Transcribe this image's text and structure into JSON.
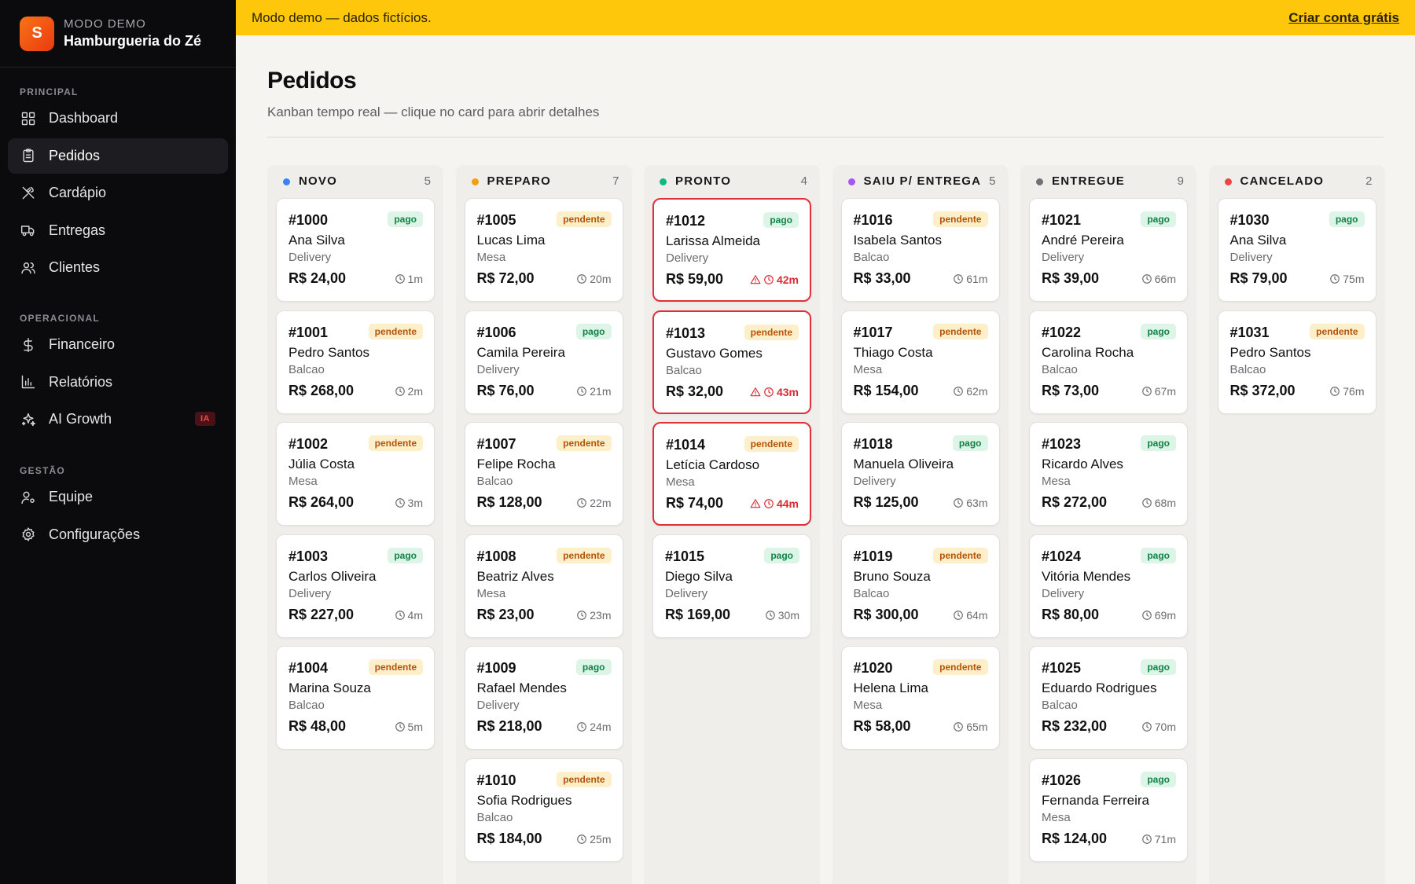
{
  "banner": {
    "text": "Modo demo — dados fictícios.",
    "cta": "Criar conta grátis"
  },
  "brand": {
    "logo_letter": "S",
    "mode": "MODO DEMO",
    "name": "Hamburgueria do Zé"
  },
  "sidebar": {
    "sections": [
      {
        "label": "PRINCIPAL",
        "items": [
          {
            "label": "Dashboard",
            "icon": "grid-icon",
            "active": false
          },
          {
            "label": "Pedidos",
            "icon": "clipboard-icon",
            "active": true
          },
          {
            "label": "Cardápio",
            "icon": "utensils-icon",
            "active": false
          },
          {
            "label": "Entregas",
            "icon": "truck-icon",
            "active": false
          },
          {
            "label": "Clientes",
            "icon": "users-icon",
            "active": false
          }
        ]
      },
      {
        "label": "OPERACIONAL",
        "items": [
          {
            "label": "Financeiro",
            "icon": "dollar-icon",
            "active": false
          },
          {
            "label": "Relatórios",
            "icon": "bar-chart-icon",
            "active": false
          },
          {
            "label": "AI Growth",
            "icon": "sparkles-icon",
            "active": false,
            "badge": "IA"
          }
        ]
      },
      {
        "label": "GESTÃO",
        "items": [
          {
            "label": "Equipe",
            "icon": "user-cog-icon",
            "active": false
          },
          {
            "label": "Configurações",
            "icon": "settings-icon",
            "active": false
          }
        ]
      }
    ]
  },
  "header": {
    "title": "Pedidos",
    "subtitle": "Kanban tempo real — clique no card para abrir detalhes"
  },
  "colors": {
    "novo": "#3b82f6",
    "preparo": "#f59e0b",
    "pronto": "#10b981",
    "saiu": "#a855f7",
    "entregue": "#71717a",
    "cancelado": "#ef4444",
    "late": "#e0313a"
  },
  "columns": [
    {
      "key": "novo",
      "title": "NOVO",
      "count": "5",
      "cards": [
        {
          "id": "#1000",
          "name": "Ana Silva",
          "type": "Delivery",
          "price": "R$ 24,00",
          "time": "1m",
          "status": "pago"
        },
        {
          "id": "#1001",
          "name": "Pedro Santos",
          "type": "Balcao",
          "price": "R$ 268,00",
          "time": "2m",
          "status": "pendente"
        },
        {
          "id": "#1002",
          "name": "Júlia Costa",
          "type": "Mesa",
          "price": "R$ 264,00",
          "time": "3m",
          "status": "pendente"
        },
        {
          "id": "#1003",
          "name": "Carlos Oliveira",
          "type": "Delivery",
          "price": "R$ 227,00",
          "time": "4m",
          "status": "pago"
        },
        {
          "id": "#1004",
          "name": "Marina Souza",
          "type": "Balcao",
          "price": "R$ 48,00",
          "time": "5m",
          "status": "pendente"
        }
      ]
    },
    {
      "key": "preparo",
      "title": "PREPARO",
      "count": "7",
      "cards": [
        {
          "id": "#1005",
          "name": "Lucas Lima",
          "type": "Mesa",
          "price": "R$ 72,00",
          "time": "20m",
          "status": "pendente"
        },
        {
          "id": "#1006",
          "name": "Camila Pereira",
          "type": "Delivery",
          "price": "R$ 76,00",
          "time": "21m",
          "status": "pago"
        },
        {
          "id": "#1007",
          "name": "Felipe Rocha",
          "type": "Balcao",
          "price": "R$ 128,00",
          "time": "22m",
          "status": "pendente"
        },
        {
          "id": "#1008",
          "name": "Beatriz Alves",
          "type": "Mesa",
          "price": "R$ 23,00",
          "time": "23m",
          "status": "pendente"
        },
        {
          "id": "#1009",
          "name": "Rafael Mendes",
          "type": "Delivery",
          "price": "R$ 218,00",
          "time": "24m",
          "status": "pago"
        },
        {
          "id": "#1010",
          "name": "Sofia Rodrigues",
          "type": "Balcao",
          "price": "R$ 184,00",
          "time": "25m",
          "status": "pendente"
        }
      ]
    },
    {
      "key": "pronto",
      "title": "PRONTO",
      "count": "4",
      "cards": [
        {
          "id": "#1012",
          "name": "Larissa Almeida",
          "type": "Delivery",
          "price": "R$ 59,00",
          "time": "42m",
          "status": "pago",
          "late": true
        },
        {
          "id": "#1013",
          "name": "Gustavo Gomes",
          "type": "Balcao",
          "price": "R$ 32,00",
          "time": "43m",
          "status": "pendente",
          "late": true
        },
        {
          "id": "#1014",
          "name": "Letícia Cardoso",
          "type": "Mesa",
          "price": "R$ 74,00",
          "time": "44m",
          "status": "pendente",
          "late": true
        },
        {
          "id": "#1015",
          "name": "Diego Silva",
          "type": "Delivery",
          "price": "R$ 169,00",
          "time": "30m",
          "status": "pago"
        }
      ]
    },
    {
      "key": "saiu",
      "title": "SAIU P/ ENTREGA",
      "count": "5",
      "cards": [
        {
          "id": "#1016",
          "name": "Isabela Santos",
          "type": "Balcao",
          "price": "R$ 33,00",
          "time": "61m",
          "status": "pendente"
        },
        {
          "id": "#1017",
          "name": "Thiago Costa",
          "type": "Mesa",
          "price": "R$ 154,00",
          "time": "62m",
          "status": "pendente"
        },
        {
          "id": "#1018",
          "name": "Manuela Oliveira",
          "type": "Delivery",
          "price": "R$ 125,00",
          "time": "63m",
          "status": "pago"
        },
        {
          "id": "#1019",
          "name": "Bruno Souza",
          "type": "Balcao",
          "price": "R$ 300,00",
          "time": "64m",
          "status": "pendente"
        },
        {
          "id": "#1020",
          "name": "Helena Lima",
          "type": "Mesa",
          "price": "R$ 58,00",
          "time": "65m",
          "status": "pendente"
        }
      ]
    },
    {
      "key": "entregue",
      "title": "ENTREGUE",
      "count": "9",
      "cards": [
        {
          "id": "#1021",
          "name": "André Pereira",
          "type": "Delivery",
          "price": "R$ 39,00",
          "time": "66m",
          "status": "pago"
        },
        {
          "id": "#1022",
          "name": "Carolina Rocha",
          "type": "Balcao",
          "price": "R$ 73,00",
          "time": "67m",
          "status": "pago"
        },
        {
          "id": "#1023",
          "name": "Ricardo Alves",
          "type": "Mesa",
          "price": "R$ 272,00",
          "time": "68m",
          "status": "pago"
        },
        {
          "id": "#1024",
          "name": "Vitória Mendes",
          "type": "Delivery",
          "price": "R$ 80,00",
          "time": "69m",
          "status": "pago"
        },
        {
          "id": "#1025",
          "name": "Eduardo Rodrigues",
          "type": "Balcao",
          "price": "R$ 232,00",
          "time": "70m",
          "status": "pago"
        },
        {
          "id": "#1026",
          "name": "Fernanda Ferreira",
          "type": "Mesa",
          "price": "R$ 124,00",
          "time": "71m",
          "status": "pago"
        }
      ]
    },
    {
      "key": "cancelado",
      "title": "CANCELADO",
      "count": "2",
      "cards": [
        {
          "id": "#1030",
          "name": "Ana Silva",
          "type": "Delivery",
          "price": "R$ 79,00",
          "time": "75m",
          "status": "pago"
        },
        {
          "id": "#1031",
          "name": "Pedro Santos",
          "type": "Balcao",
          "price": "R$ 372,00",
          "time": "76m",
          "status": "pendente"
        }
      ]
    }
  ]
}
